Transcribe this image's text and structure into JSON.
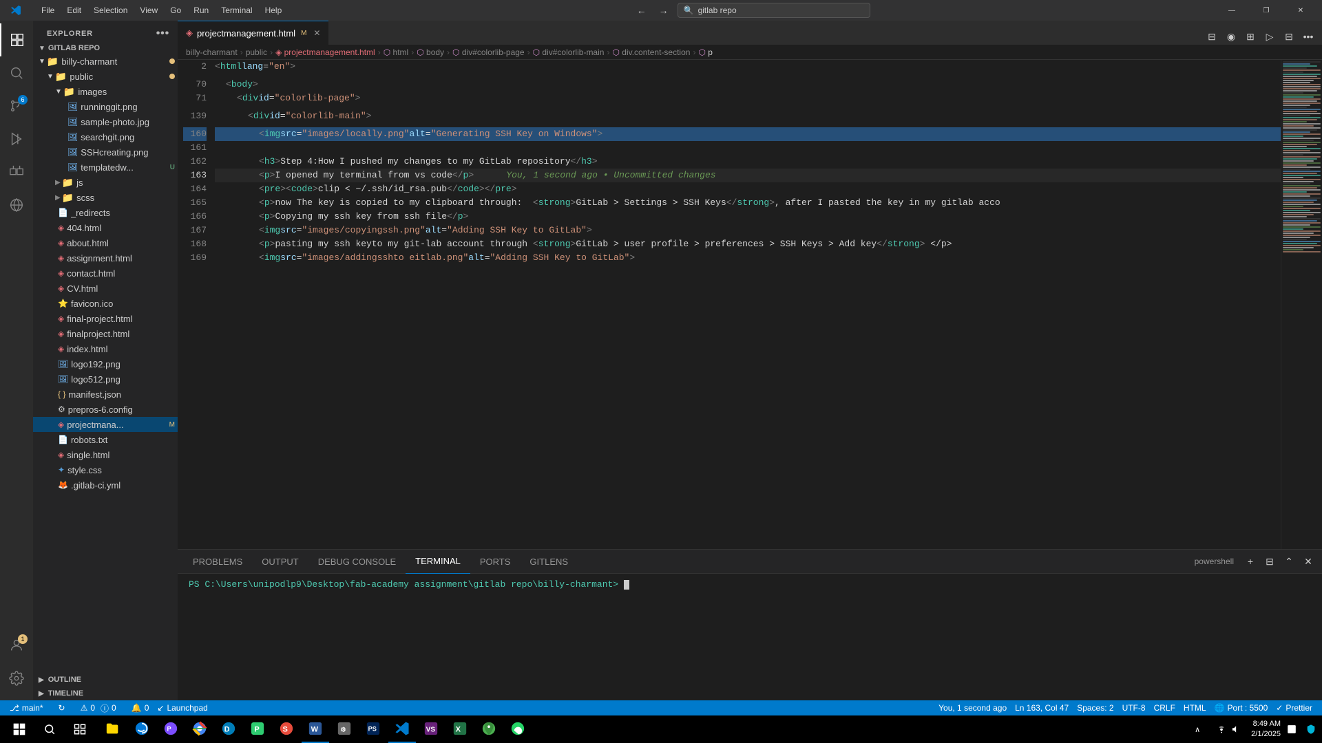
{
  "titlebar": {
    "logo": "VS",
    "menus": [
      "File",
      "Edit",
      "Selection",
      "View",
      "Go",
      "Run",
      "Terminal",
      "Help"
    ],
    "search_text": "gitlab repo",
    "search_icon": "🔍",
    "nav_back": "←",
    "nav_forward": "→",
    "win_minimize": "—",
    "win_maximize": "□",
    "win_restore": "❐",
    "win_close": "✕"
  },
  "activity_bar": {
    "icons": [
      {
        "name": "explorer-icon",
        "symbol": "⊞",
        "active": true
      },
      {
        "name": "search-icon",
        "symbol": "🔍",
        "active": false
      },
      {
        "name": "source-control-icon",
        "symbol": "⎇",
        "active": false,
        "badge": "6"
      },
      {
        "name": "run-icon",
        "symbol": "▷",
        "active": false
      },
      {
        "name": "extensions-icon",
        "symbol": "⊟",
        "active": false
      },
      {
        "name": "remote-icon",
        "symbol": "◎",
        "active": false
      }
    ],
    "bottom_icons": [
      {
        "name": "accounts-icon",
        "symbol": "👤",
        "badge": "1"
      },
      {
        "name": "settings-icon",
        "symbol": "⚙"
      }
    ]
  },
  "sidebar": {
    "title": "EXPLORER",
    "more_icon": "•••",
    "repo_name": "GITLAB REPO",
    "root_folder": "billy-charmant",
    "folders": [
      {
        "name": "public",
        "indent": 1,
        "expanded": true,
        "type": "folder"
      },
      {
        "name": "images",
        "indent": 2,
        "expanded": true,
        "type": "folder"
      },
      {
        "name": "runninggit.png",
        "indent": 3,
        "type": "image"
      },
      {
        "name": "sample-photo.jpg",
        "indent": 3,
        "type": "image"
      },
      {
        "name": "searchgit.png",
        "indent": 3,
        "type": "image"
      },
      {
        "name": "SSHcreating.png",
        "indent": 3,
        "type": "image"
      },
      {
        "name": "templatedw...",
        "indent": 3,
        "type": "image",
        "badge": "U"
      },
      {
        "name": "js",
        "indent": 2,
        "type": "folder",
        "collapsed": true
      },
      {
        "name": "scss",
        "indent": 2,
        "type": "folder",
        "collapsed": true
      },
      {
        "name": "_redirects",
        "indent": 2,
        "type": "file"
      },
      {
        "name": "404.html",
        "indent": 2,
        "type": "html"
      },
      {
        "name": "about.html",
        "indent": 2,
        "type": "html"
      },
      {
        "name": "assignment.html",
        "indent": 2,
        "type": "html"
      },
      {
        "name": "contact.html",
        "indent": 2,
        "type": "html"
      },
      {
        "name": "CV.html",
        "indent": 2,
        "type": "html"
      },
      {
        "name": "favicon.ico",
        "indent": 2,
        "type": "ico"
      },
      {
        "name": "final-project.html",
        "indent": 2,
        "type": "html"
      },
      {
        "name": "finalproject.html",
        "indent": 2,
        "type": "html"
      },
      {
        "name": "index.html",
        "indent": 2,
        "type": "html"
      },
      {
        "name": "logo192.png",
        "indent": 2,
        "type": "image"
      },
      {
        "name": "logo512.png",
        "indent": 2,
        "type": "image"
      },
      {
        "name": "manifest.json",
        "indent": 2,
        "type": "json"
      },
      {
        "name": "prepros-6.config",
        "indent": 2,
        "type": "config"
      },
      {
        "name": "projectmana...",
        "indent": 2,
        "type": "html",
        "badge": "M",
        "active": true
      },
      {
        "name": "robots.txt",
        "indent": 2,
        "type": "text"
      },
      {
        "name": "single.html",
        "indent": 2,
        "type": "html"
      },
      {
        "name": "style.css",
        "indent": 2,
        "type": "css"
      },
      {
        "name": ".gitlab-ci.yml",
        "indent": 2,
        "type": "yaml"
      }
    ],
    "outline": "OUTLINE",
    "timeline": "TIMELINE"
  },
  "tab_bar": {
    "tabs": [
      {
        "label": "projectmanagement.html",
        "modified": true,
        "active": true,
        "icon": "html"
      }
    ]
  },
  "breadcrumb": {
    "items": [
      "billy-charmant",
      "public",
      "projectmanagement.html",
      "html",
      "body",
      "div#colorlib-page",
      "div#colorlib-main",
      "div.content-section",
      "p"
    ]
  },
  "editor": {
    "lines": [
      {
        "num": 2,
        "content": "    <html lang=\"en\">",
        "type": "code"
      },
      {
        "num": 70,
        "content": "    <body>",
        "type": "code"
      },
      {
        "num": 71,
        "content": "        <div id=\"colorlib-page\">",
        "type": "code"
      },
      {
        "num": 139,
        "content": "            <div id=\"colorlib-main\">",
        "type": "code"
      },
      {
        "num": 160,
        "content": "                <img src=\"images/locally.png\" alt=\"Generating SSH Key on Windows\">",
        "type": "code",
        "highlighted": true
      },
      {
        "num": 161,
        "content": "",
        "type": "empty"
      },
      {
        "num": 162,
        "content": "                <h3>Step 4:How I pushed my changes to my GitLab repository</h3>",
        "type": "code"
      },
      {
        "num": 163,
        "content": "                <p>I opened my terminal from vs code</p>    You, 1 second ago • Uncommitted changes",
        "type": "code",
        "current": true
      },
      {
        "num": 164,
        "content": "                <pre><code>clip < ~/.ssh/id_rsa.pub</code></pre>",
        "type": "code"
      },
      {
        "num": 165,
        "content": "                <p>now The key is copied to my clipboard through:  <strong>GitLab > Settings > SSH Keys</strong>, after I pasted the key in my gitlab acco",
        "type": "code"
      },
      {
        "num": 166,
        "content": "                <p>Copying my ssh key from ssh file</p>",
        "type": "code"
      },
      {
        "num": 167,
        "content": "                <img src=\"images/copyingssh.png\" alt=\"Adding SSH Key to GitLab\">",
        "type": "code"
      },
      {
        "num": 168,
        "content": "                <p>pasting my ssh keyto my git-lab account through <strong>GitLab > user profile > preferences > SSH Keys > Add key</strong> </p>",
        "type": "code"
      },
      {
        "num": 169,
        "content": "                <img src=\"images/addingsshto eitlab.png\" alt=\"Adding SSH Key to GitLab\">",
        "type": "code"
      }
    ]
  },
  "panel": {
    "tabs": [
      "PROBLEMS",
      "OUTPUT",
      "DEBUG CONSOLE",
      "TERMINAL",
      "PORTS",
      "GITLENS"
    ],
    "active_tab": "TERMINAL",
    "terminal_label": "powershell",
    "terminal_content": "PS C:\\Users\\unipodlp9\\Desktop\\fab-academy assignment\\gitlab repo\\billy-charmant> "
  },
  "status_bar": {
    "branch": "⎇ main*",
    "sync_icon": "↻",
    "errors": "⚠ 0  ⓘ 0",
    "warning_count": "0",
    "error_count": "0",
    "launchpad": "Launchpad",
    "sync2": "↻",
    "status_right": "You, 1 second ago",
    "position": "Ln 163, Col 47",
    "spaces": "Spaces: 2",
    "encoding": "UTF-8",
    "line_ending": "CRLF",
    "language": "HTML",
    "port": "Port : 5500",
    "formatter": "Prettier"
  },
  "taskbar": {
    "time": "8:49 AM",
    "date": "2/1/2025",
    "apps": [
      "⊞",
      "🔍",
      "⊟",
      "📁",
      "🌐",
      "💻",
      "⚙",
      "🎮",
      "📊",
      "🖊",
      "🗒",
      "📧",
      "💬"
    ]
  }
}
